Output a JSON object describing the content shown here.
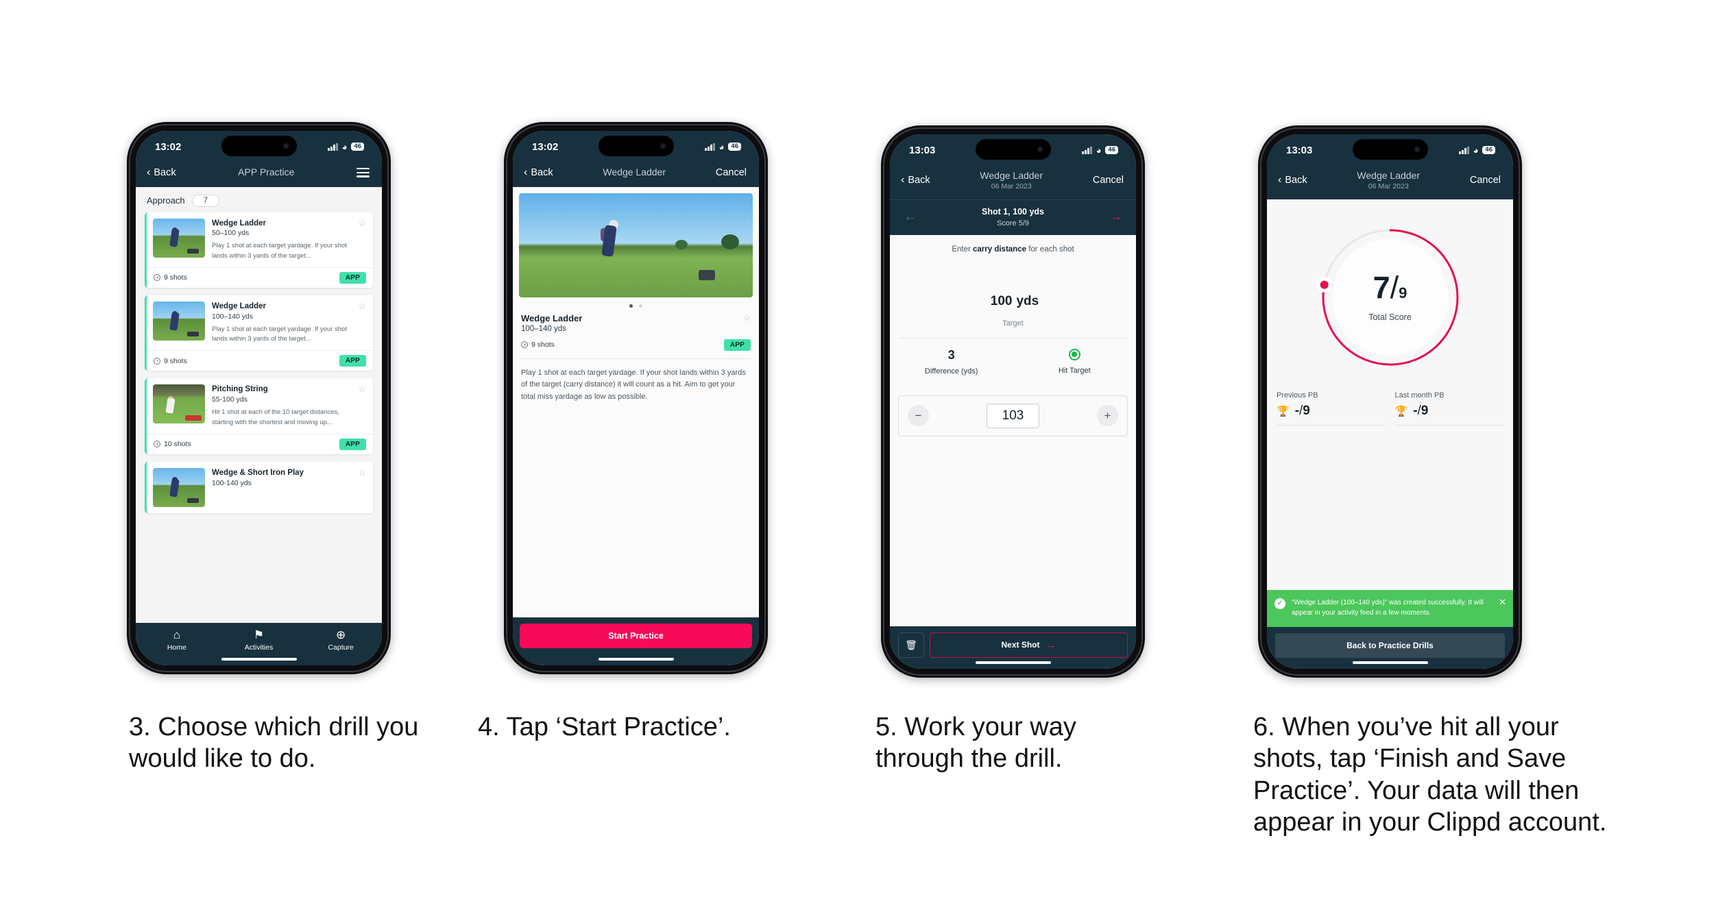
{
  "phones": [
    {
      "id": "phone-1",
      "status": {
        "time": "13:02",
        "battery": "46",
        "wifi_icon": "wifi-icon",
        "signal_icon": "cellular-icon"
      },
      "nav": {
        "back": "Back",
        "title": "APP Practice",
        "menu_icon": "hamburger-menu-icon"
      },
      "section": {
        "label": "Approach",
        "count": "7"
      },
      "cards": [
        {
          "title": "Wedge Ladder",
          "yards": "50–100 yds",
          "desc": "Play 1 shot at each target yardage. If your shot lands within 3 yards of the target...",
          "shots": "9 shots",
          "badge": "APP",
          "star_icon": "star-outline-icon"
        },
        {
          "title": "Wedge Ladder",
          "yards": "100–140 yds",
          "desc": "Play 1 shot at each target yardage. If your shot lands within 3 yards of the target...",
          "shots": "9 shots",
          "badge": "APP",
          "star_icon": "star-outline-icon"
        },
        {
          "title": "Pitching String",
          "yards": "55-100 yds",
          "desc": "Hit 1 shot at each of the 10 target distances, starting with the shortest and moving up...",
          "shots": "10 shots",
          "badge": "APP",
          "star_icon": "star-outline-icon"
        },
        {
          "title": "Wedge & Short Iron Play",
          "yards": "100-140 yds",
          "desc": "",
          "shots": "",
          "badge": "",
          "star_icon": "star-outline-icon"
        }
      ],
      "tabs": [
        {
          "label": "Home",
          "icon": "home-icon",
          "glyph": "⌂"
        },
        {
          "label": "Activities",
          "icon": "golf-flag-icon",
          "glyph": "⚑"
        },
        {
          "label": "Capture",
          "icon": "plus-circle-icon",
          "glyph": "⊕"
        }
      ]
    },
    {
      "id": "phone-2",
      "status": {
        "time": "13:02",
        "battery": "46"
      },
      "nav": {
        "back": "Back",
        "title": "Wedge Ladder",
        "cancel": "Cancel"
      },
      "drill": {
        "title": "Wedge Ladder",
        "yards": "100–140 yds",
        "shots": "9 shots",
        "badge": "APP",
        "description": "Play 1 shot at each target yardage. If your shot lands within 3 yards of the target (carry distance) it will count as a hit. Aim to get your total miss yardage as low as possible.",
        "star_icon": "star-outline-icon"
      },
      "cta": "Start Practice"
    },
    {
      "id": "phone-3",
      "status": {
        "time": "13:03",
        "battery": "46"
      },
      "nav": {
        "back": "Back",
        "title": "Wedge Ladder",
        "subtitle": "06 Mar 2023",
        "cancel": "Cancel"
      },
      "shotbar": {
        "title": "Shot 1, 100 yds",
        "score": "Score 5/9",
        "prev_icon": "arrow-left-icon",
        "next_icon": "arrow-right-icon"
      },
      "prompt_pre": "Enter ",
      "prompt_bold": "carry distance",
      "prompt_post": " for each shot",
      "target": {
        "value": "100",
        "unit": "yds",
        "label": "Target"
      },
      "stats": [
        {
          "value": "3",
          "label": "Difference (yds)"
        },
        {
          "value": "",
          "label": "Hit Target",
          "icon": "target-hit-icon"
        }
      ],
      "stepper": {
        "minus": "−",
        "value": "103",
        "plus": "+"
      },
      "footer": {
        "delete_icon": "trash-icon",
        "next": "Next Shot",
        "next_arrow": "arrow-right-icon"
      }
    },
    {
      "id": "phone-4",
      "status": {
        "time": "13:03",
        "battery": "46"
      },
      "nav": {
        "back": "Back",
        "title": "Wedge Ladder",
        "subtitle": "06 Mar 2023",
        "cancel": "Cancel"
      },
      "ring": {
        "score": "7",
        "divider": "/",
        "total": "9",
        "label": "Total Score",
        "percent": 78,
        "accent": "#e5104e",
        "track": "#e7e8ea"
      },
      "pbs": [
        {
          "label": "Previous PB",
          "value": "-",
          "total": "9",
          "icon": "trophy-icon"
        },
        {
          "label": "Last month PB",
          "value": "-",
          "total": "9",
          "icon": "trophy-icon"
        }
      ],
      "toast": {
        "message": "\"Wedge Ladder (100–140 yds)\" was created successfully. It will appear in your activity feed in a few moments.",
        "check_icon": "check-circle-icon",
        "close_icon": "close-icon",
        "color": "#4cc75c"
      },
      "footer_button": "Back to Practice Drills"
    }
  ],
  "captions": [
    "3. Choose which drill you would like to do.",
    "4. Tap ‘Start Practice’.",
    "5. Work your way through the drill.",
    "6. When you’ve hit all your shots, tap ‘Finish and Save Practice’. Your data will then appear in your Clippd account."
  ]
}
